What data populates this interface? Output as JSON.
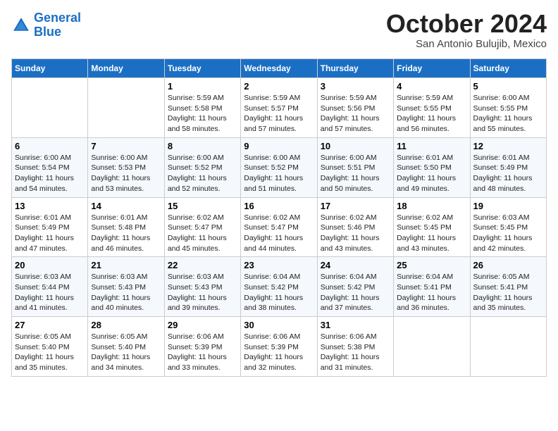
{
  "logo": {
    "line1": "General",
    "line2": "Blue"
  },
  "title": "October 2024",
  "location": "San Antonio Bulujib, Mexico",
  "days_of_week": [
    "Sunday",
    "Monday",
    "Tuesday",
    "Wednesday",
    "Thursday",
    "Friday",
    "Saturday"
  ],
  "weeks": [
    [
      {
        "day": "",
        "info": ""
      },
      {
        "day": "",
        "info": ""
      },
      {
        "day": "1",
        "info": "Sunrise: 5:59 AM\nSunset: 5:58 PM\nDaylight: 11 hours and 58 minutes."
      },
      {
        "day": "2",
        "info": "Sunrise: 5:59 AM\nSunset: 5:57 PM\nDaylight: 11 hours and 57 minutes."
      },
      {
        "day": "3",
        "info": "Sunrise: 5:59 AM\nSunset: 5:56 PM\nDaylight: 11 hours and 57 minutes."
      },
      {
        "day": "4",
        "info": "Sunrise: 5:59 AM\nSunset: 5:55 PM\nDaylight: 11 hours and 56 minutes."
      },
      {
        "day": "5",
        "info": "Sunrise: 6:00 AM\nSunset: 5:55 PM\nDaylight: 11 hours and 55 minutes."
      }
    ],
    [
      {
        "day": "6",
        "info": "Sunrise: 6:00 AM\nSunset: 5:54 PM\nDaylight: 11 hours and 54 minutes."
      },
      {
        "day": "7",
        "info": "Sunrise: 6:00 AM\nSunset: 5:53 PM\nDaylight: 11 hours and 53 minutes."
      },
      {
        "day": "8",
        "info": "Sunrise: 6:00 AM\nSunset: 5:52 PM\nDaylight: 11 hours and 52 minutes."
      },
      {
        "day": "9",
        "info": "Sunrise: 6:00 AM\nSunset: 5:52 PM\nDaylight: 11 hours and 51 minutes."
      },
      {
        "day": "10",
        "info": "Sunrise: 6:00 AM\nSunset: 5:51 PM\nDaylight: 11 hours and 50 minutes."
      },
      {
        "day": "11",
        "info": "Sunrise: 6:01 AM\nSunset: 5:50 PM\nDaylight: 11 hours and 49 minutes."
      },
      {
        "day": "12",
        "info": "Sunrise: 6:01 AM\nSunset: 5:49 PM\nDaylight: 11 hours and 48 minutes."
      }
    ],
    [
      {
        "day": "13",
        "info": "Sunrise: 6:01 AM\nSunset: 5:49 PM\nDaylight: 11 hours and 47 minutes."
      },
      {
        "day": "14",
        "info": "Sunrise: 6:01 AM\nSunset: 5:48 PM\nDaylight: 11 hours and 46 minutes."
      },
      {
        "day": "15",
        "info": "Sunrise: 6:02 AM\nSunset: 5:47 PM\nDaylight: 11 hours and 45 minutes."
      },
      {
        "day": "16",
        "info": "Sunrise: 6:02 AM\nSunset: 5:47 PM\nDaylight: 11 hours and 44 minutes."
      },
      {
        "day": "17",
        "info": "Sunrise: 6:02 AM\nSunset: 5:46 PM\nDaylight: 11 hours and 43 minutes."
      },
      {
        "day": "18",
        "info": "Sunrise: 6:02 AM\nSunset: 5:45 PM\nDaylight: 11 hours and 43 minutes."
      },
      {
        "day": "19",
        "info": "Sunrise: 6:03 AM\nSunset: 5:45 PM\nDaylight: 11 hours and 42 minutes."
      }
    ],
    [
      {
        "day": "20",
        "info": "Sunrise: 6:03 AM\nSunset: 5:44 PM\nDaylight: 11 hours and 41 minutes."
      },
      {
        "day": "21",
        "info": "Sunrise: 6:03 AM\nSunset: 5:43 PM\nDaylight: 11 hours and 40 minutes."
      },
      {
        "day": "22",
        "info": "Sunrise: 6:03 AM\nSunset: 5:43 PM\nDaylight: 11 hours and 39 minutes."
      },
      {
        "day": "23",
        "info": "Sunrise: 6:04 AM\nSunset: 5:42 PM\nDaylight: 11 hours and 38 minutes."
      },
      {
        "day": "24",
        "info": "Sunrise: 6:04 AM\nSunset: 5:42 PM\nDaylight: 11 hours and 37 minutes."
      },
      {
        "day": "25",
        "info": "Sunrise: 6:04 AM\nSunset: 5:41 PM\nDaylight: 11 hours and 36 minutes."
      },
      {
        "day": "26",
        "info": "Sunrise: 6:05 AM\nSunset: 5:41 PM\nDaylight: 11 hours and 35 minutes."
      }
    ],
    [
      {
        "day": "27",
        "info": "Sunrise: 6:05 AM\nSunset: 5:40 PM\nDaylight: 11 hours and 35 minutes."
      },
      {
        "day": "28",
        "info": "Sunrise: 6:05 AM\nSunset: 5:40 PM\nDaylight: 11 hours and 34 minutes."
      },
      {
        "day": "29",
        "info": "Sunrise: 6:06 AM\nSunset: 5:39 PM\nDaylight: 11 hours and 33 minutes."
      },
      {
        "day": "30",
        "info": "Sunrise: 6:06 AM\nSunset: 5:39 PM\nDaylight: 11 hours and 32 minutes."
      },
      {
        "day": "31",
        "info": "Sunrise: 6:06 AM\nSunset: 5:38 PM\nDaylight: 11 hours and 31 minutes."
      },
      {
        "day": "",
        "info": ""
      },
      {
        "day": "",
        "info": ""
      }
    ]
  ]
}
